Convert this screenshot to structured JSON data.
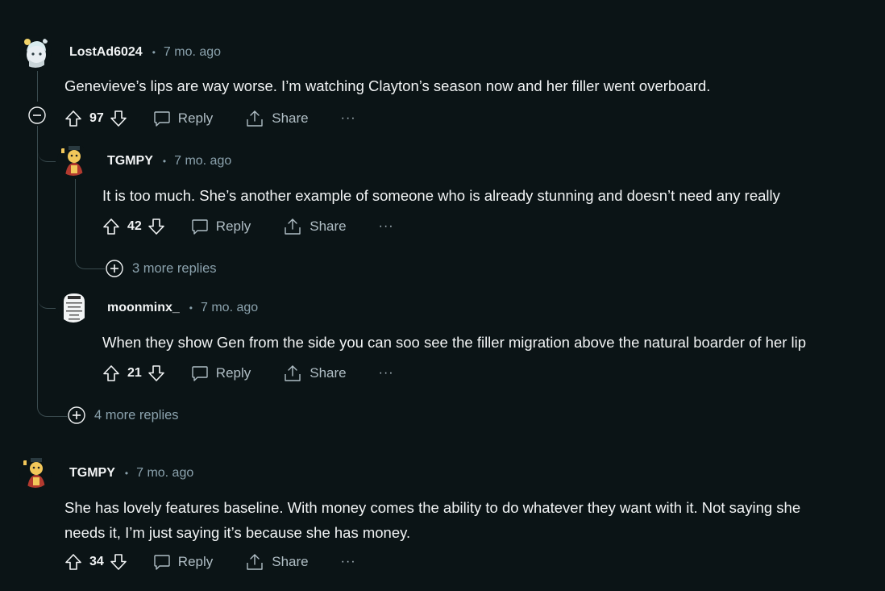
{
  "comments": [
    {
      "username": "LostAd6024",
      "time": "7 mo. ago",
      "body": [
        "Genevieve’s lips are way worse. I’m watching Clayton’s season now and her filler went overboard."
      ],
      "votes": "97",
      "reply_label": "Reply",
      "share_label": "Share",
      "more_label": "···",
      "replies": [
        {
          "username": "TGMPY",
          "time": "7 mo. ago",
          "body": [
            "It is too much. She’s another example of someone who is already stunning and doesn’t need any really"
          ],
          "votes": "42",
          "reply_label": "Reply",
          "share_label": "Share",
          "more_label": "···",
          "more_replies": "3 more replies"
        },
        {
          "username": "moonminx_",
          "time": "7 mo. ago",
          "body": [
            "When they show Gen from the side you can soo see the filler migration above the natural boarder of her lip"
          ],
          "votes": "21",
          "reply_label": "Reply",
          "share_label": "Share",
          "more_label": "···"
        }
      ],
      "more_replies": "4 more replies"
    },
    {
      "username": "TGMPY",
      "time": "7 mo. ago",
      "body": [
        "She has lovely features baseline. With money comes the ability to do whatever they want with it. Not saying she",
        "needs it, I’m just saying it’s because she has money."
      ],
      "votes": "34",
      "reply_label": "Reply",
      "share_label": "Share",
      "more_label": "···"
    }
  ],
  "icons": {
    "upvote": "upvote-arrow-icon",
    "downvote": "downvote-arrow-icon",
    "reply": "speech-bubble-icon",
    "share": "share-upload-icon",
    "collapse": "minus-circle-icon",
    "expand": "plus-circle-icon"
  },
  "colors": {
    "background": "#0b1416",
    "text": "#f2f4f5",
    "muted": "#8ba2ad",
    "thread_line": "#3a4b4f"
  }
}
